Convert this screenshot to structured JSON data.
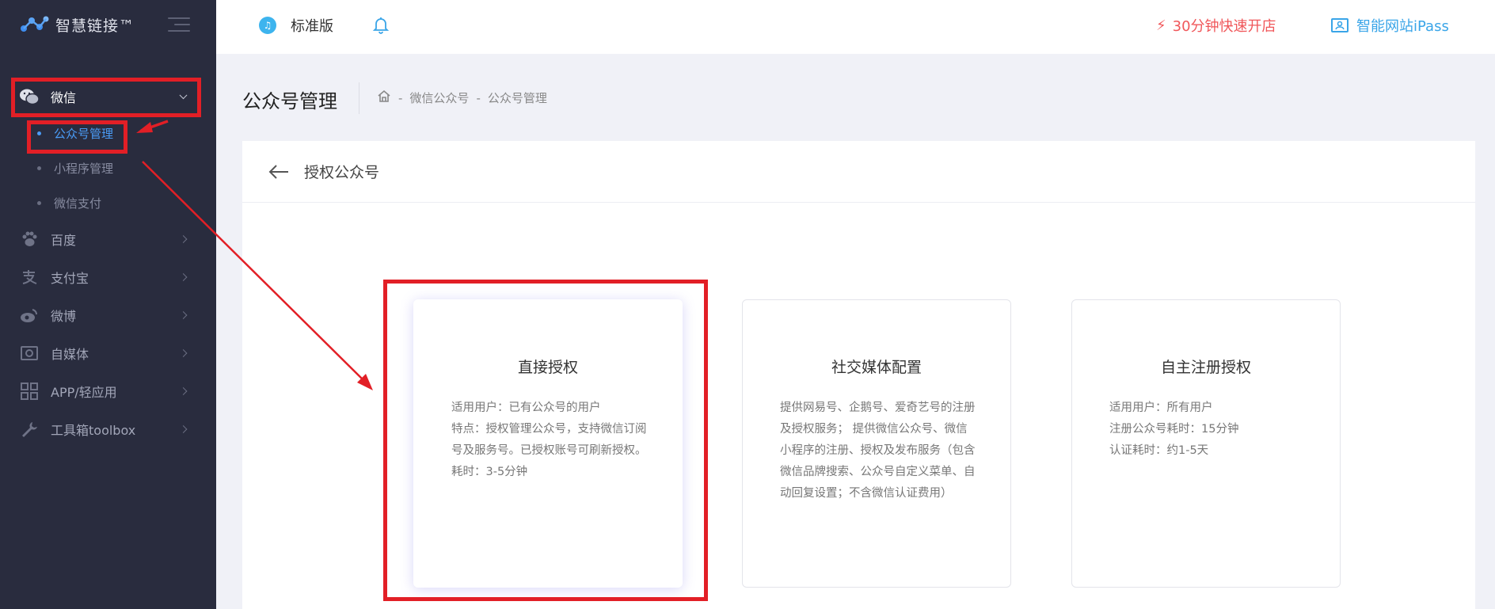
{
  "brand": {
    "logo_text": "智慧链接™"
  },
  "header": {
    "edition_label": "标准版",
    "quick_open_label": "30分钟快速开店",
    "ipass_label": "智能网站iPass"
  },
  "sidebar": {
    "menus": [
      {
        "label": "微信",
        "icon": "wechat-icon",
        "expanded": true
      },
      {
        "label": "百度",
        "icon": "paw-icon"
      },
      {
        "label": "支付宝",
        "icon": "alipay-icon"
      },
      {
        "label": "微博",
        "icon": "weibo-icon"
      },
      {
        "label": "自媒体",
        "icon": "media-icon"
      },
      {
        "label": "APP/轻应用",
        "icon": "app-grid-icon"
      },
      {
        "label": "工具箱toolbox",
        "icon": "wrench-icon"
      }
    ],
    "wechat_sub": [
      {
        "label": "公众号管理",
        "active": true
      },
      {
        "label": "小程序管理"
      },
      {
        "label": "微信支付"
      }
    ]
  },
  "page": {
    "title": "公众号管理",
    "breadcrumb": [
      "微信公众号",
      "公众号管理"
    ]
  },
  "panel": {
    "title": "授权公众号",
    "cards": [
      {
        "title": "直接授权",
        "lines": [
          "适用用户：已有公众号的用户",
          "特点：授权管理公众号，支持微信订阅号及服务号。已授权账号可刷新授权。",
          "耗时：3-5分钟"
        ]
      },
      {
        "title": "社交媒体配置",
        "lines": [
          "提供网易号、企鹅号、爱奇艺号的注册及授权服务； 提供微信公众号、微信小程序的注册、授权及发布服务（包含微信品牌搜索、公众号自定义菜单、自动回复设置；不含微信认证费用）"
        ]
      },
      {
        "title": "自主注册授权",
        "lines": [
          "适用用户：所有用户",
          "注册公众号耗时：15分钟",
          "认证耗时：约1-5天"
        ]
      }
    ]
  },
  "colors": {
    "sidebar_bg": "#292c3e",
    "active_blue": "#4a9cf6",
    "accent_red": "#f0575a",
    "annotation_red": "#e21f26"
  }
}
